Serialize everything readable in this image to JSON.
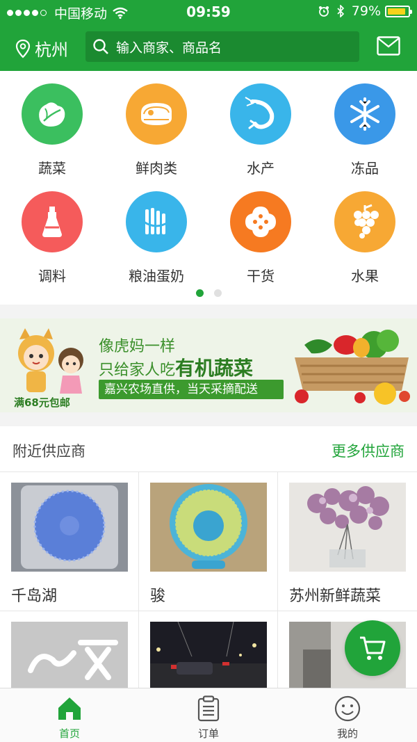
{
  "status_bar": {
    "carrier": "中国移动",
    "time": "09:59",
    "battery": "79%",
    "battery_level": 0.79,
    "signal_icon": "signal-dots-icon",
    "wifi_icon": "wifi-icon",
    "alarm_icon": "alarm-icon",
    "bluetooth_icon": "bluetooth-icon"
  },
  "header": {
    "city": "杭州",
    "search_placeholder": "输入商家、商品名",
    "location_icon": "location-pin-icon",
    "search_icon": "search-icon",
    "message_icon": "mail-icon",
    "brand_color": "#21a43a"
  },
  "categories": [
    {
      "label": "蔬菜",
      "color": "#3bbf5f",
      "icon": "vegetable-icon"
    },
    {
      "label": "鲜肉类",
      "color": "#f7a834",
      "icon": "meat-icon"
    },
    {
      "label": "水产",
      "color": "#39b5ea",
      "icon": "shrimp-icon"
    },
    {
      "label": "冻品",
      "color": "#3a98e8",
      "icon": "snowflake-icon"
    },
    {
      "label": "调料",
      "color": "#f55b5b",
      "icon": "seasoning-bottle-icon"
    },
    {
      "label": "粮油蛋奶",
      "color": "#39b5ea",
      "icon": "grain-icon"
    },
    {
      "label": "干货",
      "color": "#f67a21",
      "icon": "dried-goods-icon"
    },
    {
      "label": "水果",
      "color": "#f7a834",
      "icon": "grapes-icon"
    }
  ],
  "pager": {
    "pages": 2,
    "current": 1
  },
  "banner": {
    "line1": "像虎妈一样",
    "line2_prefix": "只给家人吃",
    "line2_highlight": "有机蔬菜",
    "line3": "嘉兴农场直供，当天采摘配送",
    "promo": "满68元包邮"
  },
  "suppliers": {
    "title": "附近供应商",
    "more": "更多供应商",
    "items": [
      {
        "name": "千岛湖",
        "image": "blue-desk-fan-photo"
      },
      {
        "name": "骏",
        "image": "teal-mini-fan-photo"
      },
      {
        "name": "苏州新鲜蔬菜",
        "image": "flowers-vase-photo"
      },
      {
        "name": "",
        "image": "logo-placeholder-photo"
      },
      {
        "name": "",
        "image": "night-street-photo"
      },
      {
        "name": "",
        "image": "interior-photo"
      }
    ]
  },
  "cart": {
    "icon": "cart-icon"
  },
  "tabbar": {
    "items": [
      {
        "label": "首页",
        "icon": "home-icon",
        "active": true
      },
      {
        "label": "订单",
        "icon": "clipboard-icon",
        "active": false
      },
      {
        "label": "我的",
        "icon": "smiley-icon",
        "active": false
      }
    ]
  }
}
